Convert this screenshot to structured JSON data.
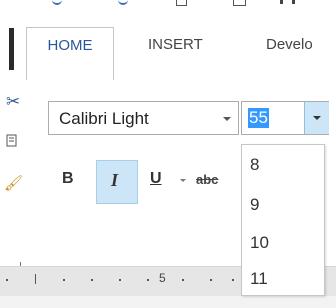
{
  "tabs": [
    {
      "label": "HOME",
      "active": true
    },
    {
      "label": "INSERT",
      "active": false
    },
    {
      "label": "Develo",
      "active": false
    }
  ],
  "font": {
    "name_value": "Calibri Light",
    "size_value": "55"
  },
  "format_buttons": {
    "bold": "B",
    "italic": "I",
    "underline": "U",
    "strikethrough": "abc"
  },
  "size_options": [
    "8",
    "9",
    "10",
    "11"
  ],
  "ruler": {
    "mark": "5"
  },
  "colors": {
    "accent": "#2b579a",
    "selection": "#3399ff",
    "hover": "#cde6f7"
  }
}
